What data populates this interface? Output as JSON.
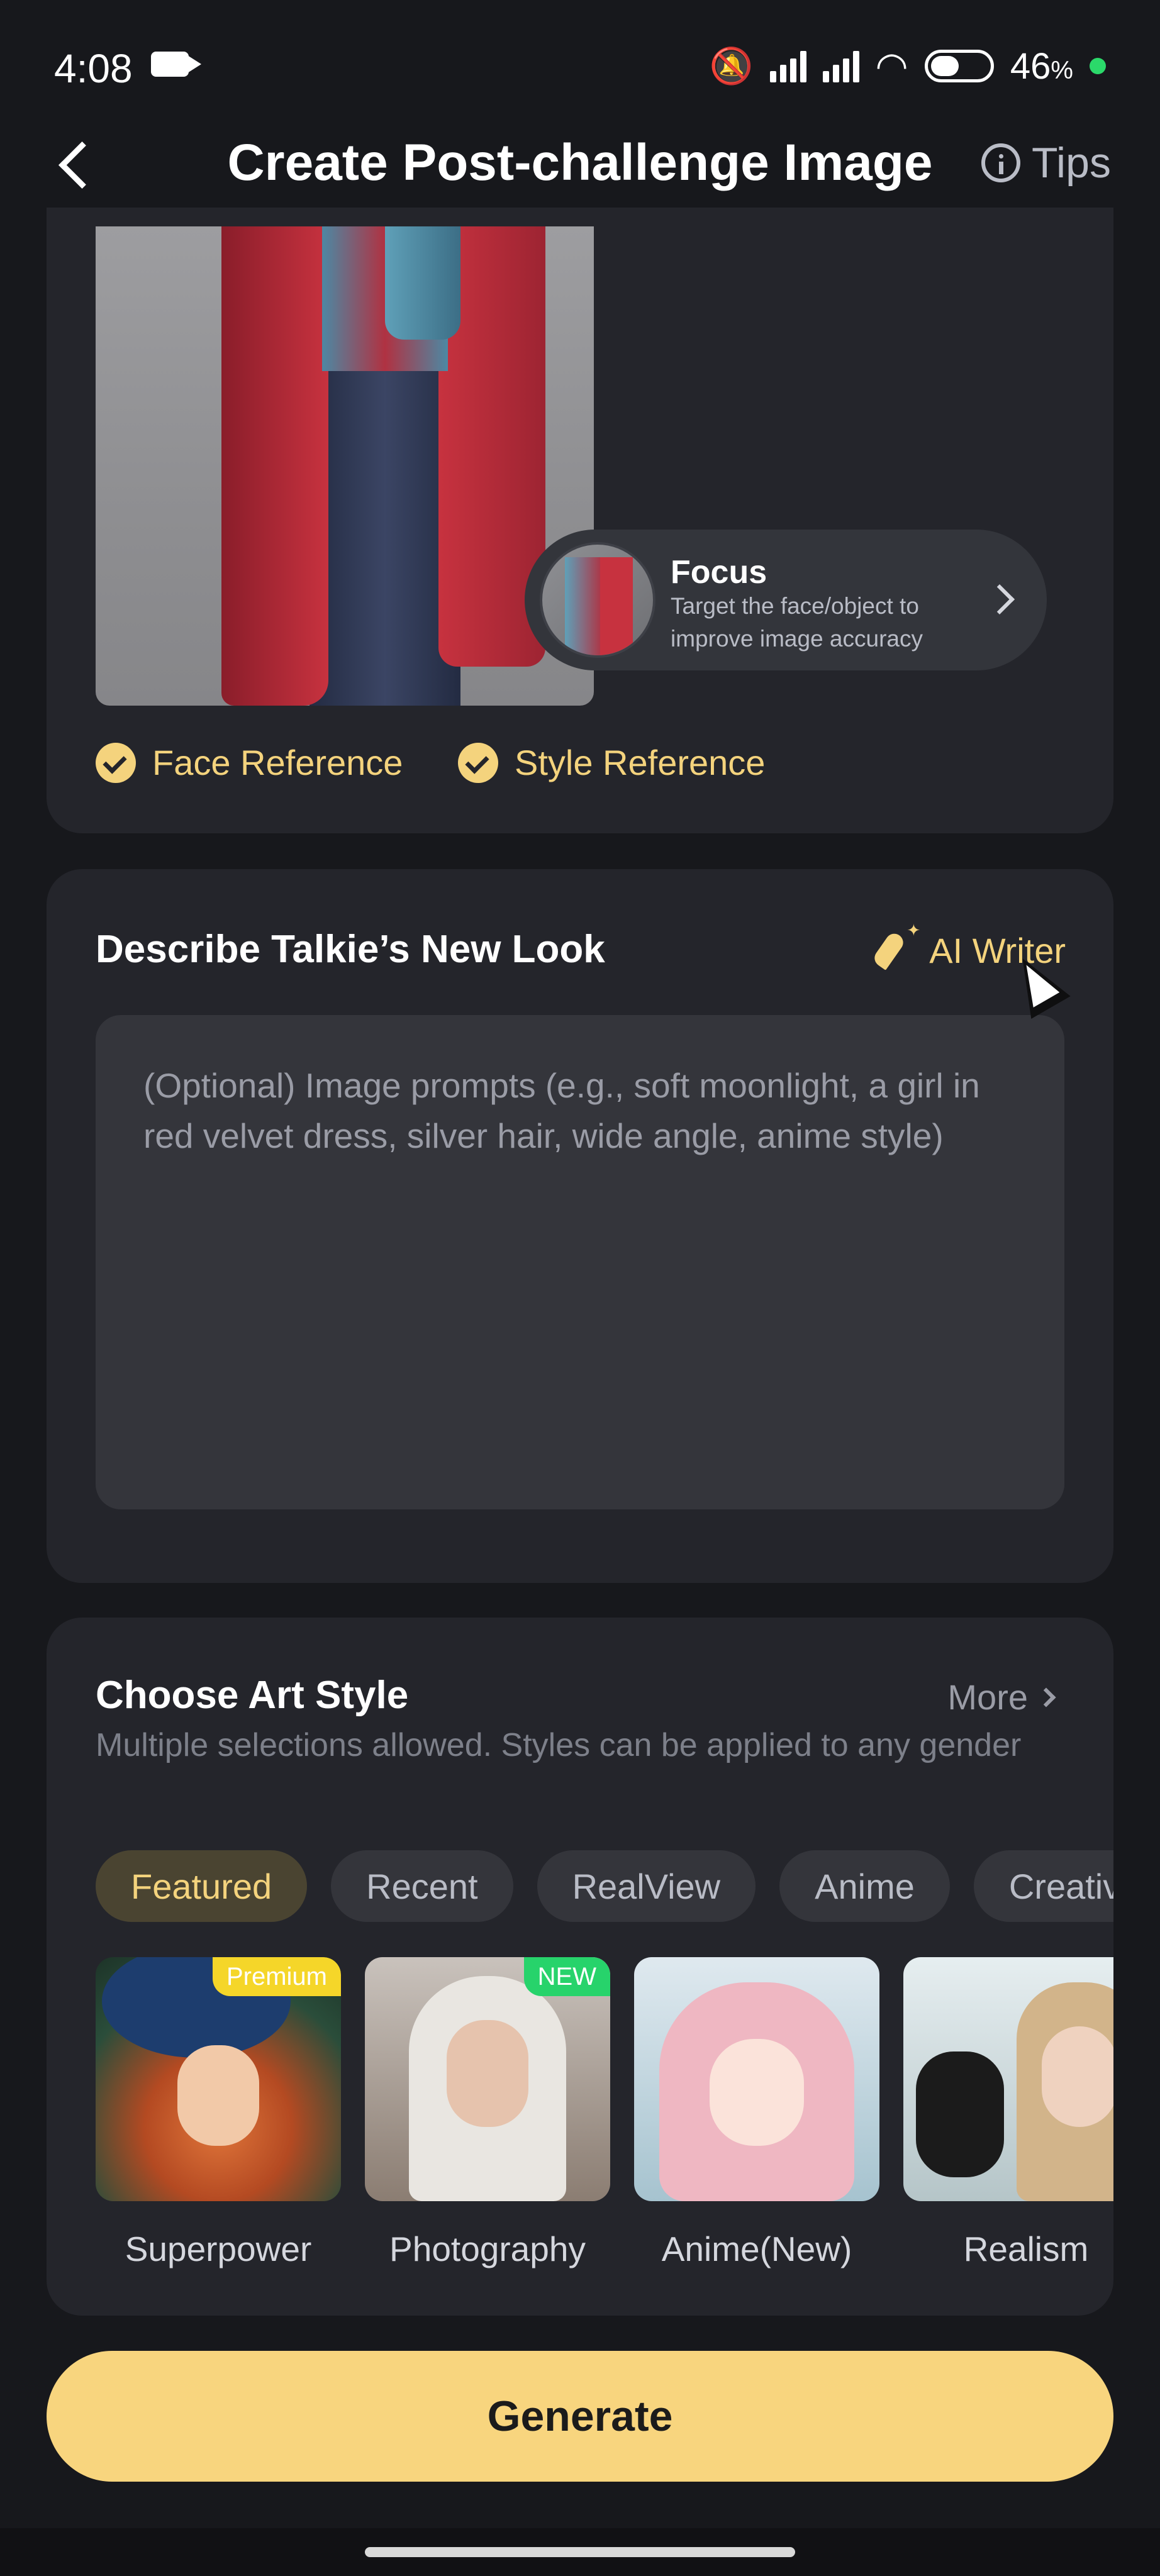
{
  "status_bar": {
    "time": "4:08",
    "battery": "46",
    "battery_unit": "%"
  },
  "header": {
    "title": "Create Post-challenge Image",
    "tips_label": "Tips"
  },
  "reference": {
    "focus_title": "Focus",
    "focus_subtitle": "Target the face/object to improve image accuracy",
    "face_reference": "Face Reference",
    "style_reference": "Style Reference"
  },
  "describe": {
    "title": "Describe Talkie’s New Look",
    "ai_writer": "AI Writer",
    "placeholder": "(Optional) Image prompts (e.g., soft moonlight, a girl in red velvet dress, silver hair, wide angle, anime style)"
  },
  "art_style": {
    "title": "Choose Art Style",
    "more": "More",
    "description": "Multiple selections allowed. Styles can be applied to any gender",
    "tabs": [
      "Featured",
      "Recent",
      "RealView",
      "Anime",
      "Creative"
    ],
    "items": [
      {
        "label": "Superpower",
        "badge": "Premium"
      },
      {
        "label": "Photography",
        "badge": "NEW"
      },
      {
        "label": "Anime(New)",
        "badge": ""
      },
      {
        "label": "Realism",
        "badge": ""
      }
    ]
  },
  "generate_label": "Generate",
  "colors": {
    "accent": "#f8d57e",
    "background": "#17181c",
    "card": "#24252b"
  }
}
